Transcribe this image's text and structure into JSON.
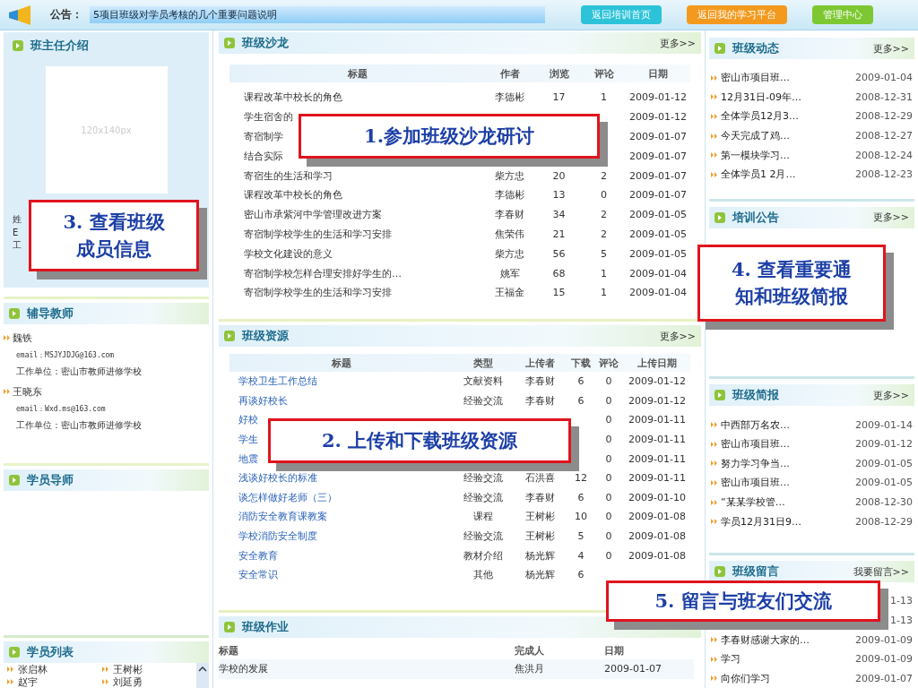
{
  "notice_bar": {
    "label": "公告：",
    "text": "5项目班级对学员考核的几个重要问题说明",
    "buttons": [
      {
        "label": "返回培训首页",
        "color": "#2cc3d8"
      },
      {
        "label": "返回我的学习平台",
        "color": "#f39a1e"
      },
      {
        "label": "管理中心",
        "color": "#7dc832"
      }
    ]
  },
  "left": {
    "head_teacher": {
      "title": "班主任介绍",
      "photo_placeholder": "120x140px",
      "fragments": [
        "姓",
        "E",
        "工"
      ]
    },
    "tutors": {
      "title": "辅导教师",
      "people": [
        {
          "name": "魏铁",
          "email": "email：MSJYJDJG@163.com",
          "unit": "工作单位：密山市教师进修学校"
        },
        {
          "name": "王晓东",
          "email": "email：Wxd.ms@163.com",
          "unit": "工作单位：密山市教师进修学校"
        }
      ]
    },
    "mentors": {
      "title": "学员导师"
    },
    "students": {
      "title": "学员列表",
      "names": [
        "张启林",
        "王树彬",
        "赵宇",
        "刘延勇"
      ]
    }
  },
  "salon": {
    "title": "班级沙龙",
    "more": "更多>>",
    "columns": [
      "标题",
      "作者",
      "浏览",
      "评论",
      "日期"
    ],
    "rows": [
      {
        "title": "课程改革中校长的角色",
        "author": "李德彬",
        "views": "17",
        "comments": "1",
        "date": "2009-01-12"
      },
      {
        "title": "学生宿舍的",
        "date": "2009-01-12"
      },
      {
        "title": "寄宿制学",
        "date": "2009-01-07"
      },
      {
        "title": "结合实际",
        "date": "2009-01-07"
      },
      {
        "title": "寄宿生的生活和学习",
        "author": "柴方忠",
        "views": "20",
        "comments": "2",
        "date": "2009-01-07"
      },
      {
        "title": "课程改革中校长的角色",
        "author": "李德彬",
        "views": "13",
        "comments": "0",
        "date": "2009-01-07"
      },
      {
        "title": "密山市承紫河中学管理改进方案",
        "author": "李春财",
        "views": "34",
        "comments": "2",
        "date": "2009-01-05"
      },
      {
        "title": "寄宿制学校学生的生活和学习安排",
        "author": "焦荣伟",
        "views": "21",
        "comments": "2",
        "date": "2009-01-05"
      },
      {
        "title": "学校文化建设的意义",
        "author": "柴方忠",
        "views": "56",
        "comments": "5",
        "date": "2009-01-05"
      },
      {
        "title": "寄宿制学校怎样合理安排好学生的…",
        "author": "姚军",
        "views": "68",
        "comments": "1",
        "date": "2009-01-04"
      },
      {
        "title": "寄宿制学校学生的生活和学习安排",
        "author": "王福金",
        "views": "15",
        "comments": "1",
        "date": "2009-01-04"
      }
    ]
  },
  "resources": {
    "title": "班级资源",
    "more": "更多>>",
    "columns": [
      "标题",
      "类型",
      "上传者",
      "下载",
      "评论",
      "上传日期"
    ],
    "rows": [
      {
        "title": "学校卫生工作总结",
        "type": "文献资料",
        "uploader": "李春财",
        "downloads": "6",
        "comments": "0",
        "date": "2009-01-12"
      },
      {
        "title": "再谈好校长",
        "type": "经验交流",
        "uploader": "李春财",
        "downloads": "6",
        "comments": "0",
        "date": "2009-01-12"
      },
      {
        "title": "好校",
        "comments": "0",
        "date": "2009-01-11"
      },
      {
        "title": "学生",
        "comments": "0",
        "date": "2009-01-11"
      },
      {
        "title": "地震",
        "comments": "0",
        "date": "2009-01-11"
      },
      {
        "title": "浅谈好校长的标准",
        "type": "经验交流",
        "uploader": "石洪喜",
        "downloads": "12",
        "comments": "0",
        "date": "2009-01-11"
      },
      {
        "title": "谈怎样做好老师（三）",
        "type": "经验交流",
        "uploader": "李春财",
        "downloads": "6",
        "comments": "0",
        "date": "2009-01-10"
      },
      {
        "title": "消防安全教育课教案",
        "type": "课程",
        "uploader": "王树彬",
        "downloads": "10",
        "comments": "0",
        "date": "2009-01-08"
      },
      {
        "title": "学校消防安全制度",
        "type": "经验交流",
        "uploader": "王树彬",
        "downloads": "5",
        "comments": "0",
        "date": "2009-01-08"
      },
      {
        "title": "安全教育",
        "type": "教材介绍",
        "uploader": "杨光辉",
        "downloads": "4",
        "comments": "0",
        "date": "2009-01-08"
      },
      {
        "title": "安全常识",
        "type": "其他",
        "uploader": "杨光辉",
        "downloads": "6"
      }
    ]
  },
  "homework": {
    "title": "班级作业",
    "columns": [
      "标题",
      "完成人",
      "日期"
    ],
    "rows": [
      {
        "title": "学校的发展",
        "person": "焦洪月",
        "date": "2009-01-07"
      }
    ]
  },
  "news": {
    "title": "班级动态",
    "more": "更多>>",
    "items": [
      {
        "text": "密山市项目班…",
        "date": "2009-01-04"
      },
      {
        "text": "12月31日-09年…",
        "date": "2008-12-31"
      },
      {
        "text": "全体学员12月3…",
        "date": "2008-12-29"
      },
      {
        "text": "今天完成了鸡…",
        "date": "2008-12-27"
      },
      {
        "text": "第一模块学习…",
        "date": "2008-12-24"
      },
      {
        "text": "全体学员1 2月…",
        "date": "2008-12-23"
      }
    ]
  },
  "notices": {
    "title": "培训公告",
    "more": "更多>>"
  },
  "briefs": {
    "title": "班级简报",
    "more": "更多>>",
    "items": [
      {
        "text": "中西部万名农…",
        "date": "2009-01-14"
      },
      {
        "text": "密山市项目班…",
        "date": "2009-01-12"
      },
      {
        "text": "努力学习争当…",
        "date": "2009-01-05"
      },
      {
        "text": "密山市项目班…",
        "date": "2009-01-05"
      },
      {
        "text": "“某某学校管…",
        "date": "2008-12-30"
      },
      {
        "text": "学员12月31日9…",
        "date": "2008-12-29"
      }
    ]
  },
  "messages": {
    "title": "班级留言",
    "more": "我要留言>>",
    "items": [
      {
        "date": "1-13"
      },
      {
        "date": "1-13"
      },
      {
        "text": "李春财感谢大家的…",
        "date": "2009-01-09"
      },
      {
        "text": "学习",
        "date": "2009-01-09"
      },
      {
        "text": "向你们学习",
        "date": "2009-01-07"
      }
    ]
  },
  "callouts": [
    {
      "lines": [
        "1.参加班级沙龙研讨"
      ]
    },
    {
      "lines": [
        "2. 上传和下载班级资源"
      ]
    },
    {
      "lines": [
        "3. 查看班级",
        "成员信息"
      ]
    },
    {
      "lines": [
        "4. 查看重要通",
        "知和班级简报"
      ]
    },
    {
      "lines": [
        "5. 留言与班友们交流"
      ]
    }
  ]
}
